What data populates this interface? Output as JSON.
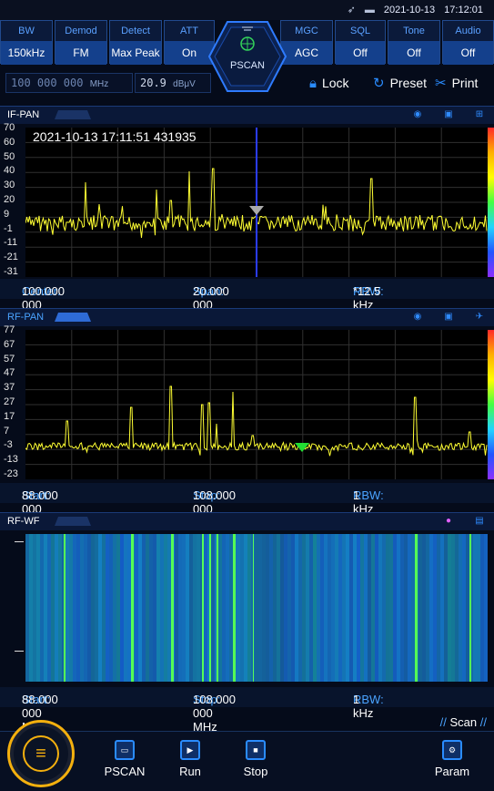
{
  "status": {
    "date": "2021-10-13",
    "time": "17:12:01"
  },
  "params": [
    {
      "header": "BW",
      "value": "150kHz"
    },
    {
      "header": "Demod",
      "value": "FM"
    },
    {
      "header": "Detect",
      "value": "Max Peak"
    },
    {
      "header": "ATT",
      "value": "On"
    },
    {
      "header": "MGC",
      "value": "AGC"
    },
    {
      "header": "SQL",
      "value": "Off"
    },
    {
      "header": "Tone",
      "value": "Off"
    },
    {
      "header": "Audio",
      "value": "Off"
    }
  ],
  "mode": "PSCAN",
  "freq": {
    "value": "100 000 000",
    "unit": "MHz"
  },
  "level": {
    "value": "20.9",
    "unit": "dBμV"
  },
  "toolbar": {
    "lock": "Lock",
    "preset": "Preset",
    "print": "Print"
  },
  "if_pan": {
    "title": "IF-PAN",
    "timestamp": "2021-10-13 17:11:51 431935",
    "yticks": [
      "70",
      "60",
      "50",
      "40",
      "30",
      "20",
      "9",
      "-1",
      "-11",
      "-21",
      "-31"
    ],
    "info": {
      "center_label": "Center:",
      "center": "100.000 000 MHz",
      "span_label": "Span:",
      "span": "20.000 000 MHz",
      "rbw_label": "RBW:",
      "rbw": "*12.5 kHz"
    }
  },
  "rf_pan": {
    "title": "RF-PAN",
    "yticks": [
      "77",
      "67",
      "57",
      "47",
      "37",
      "27",
      "17",
      "7",
      "-3",
      "-13",
      "-23"
    ],
    "info": {
      "start_label": "Start:",
      "start": "88.000 000 MHz",
      "stop_label": "Stop:",
      "stop": "108.000 000 MHz",
      "rbw_label": "RBW:",
      "rbw": "1 kHz"
    }
  },
  "rf_wf": {
    "title": "RF-WF",
    "info": {
      "start_label": "Start:",
      "start": "88.000 000 MHz",
      "stop_label": "Stop:",
      "stop": "108.000 000 MHz",
      "rbw_label": "RBW:",
      "rbw": "1 kHz"
    }
  },
  "scan_tab": "Scan",
  "bottom": {
    "pscan": "PSCAN",
    "run": "Run",
    "stop": "Stop",
    "param": "Param"
  },
  "icons": {
    "send": "send-icon",
    "battery": "battery-icon"
  },
  "colors": {
    "accent": "#2a8cff",
    "trace": "#ffff33",
    "menu_ring": "#f4b00e"
  }
}
